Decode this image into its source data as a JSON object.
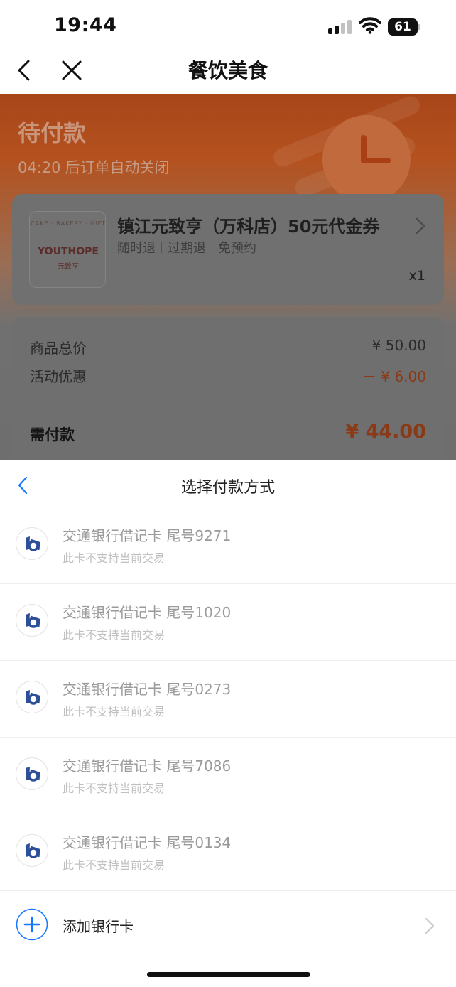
{
  "status_bar": {
    "time": "19:44",
    "battery": "61",
    "icons": [
      "signal-icon",
      "wifi-icon",
      "battery-icon"
    ]
  },
  "nav": {
    "title": "餐饮美食",
    "icons": [
      "back-icon",
      "close-icon"
    ]
  },
  "order": {
    "status": "待付款",
    "countdown_time": "04:20",
    "countdown_text": "后订单自动关闭",
    "product": {
      "logo_arc_text": "CAKE · BAKERY · GIFT",
      "logo_main_text": "YOUTHOPE",
      "logo_sub_text": "元致亨",
      "name": "镇江元致亨（万科店）50元代金券",
      "tags": [
        "随时退",
        "过期退",
        "免预约"
      ],
      "quantity": "x1"
    },
    "price": {
      "total_label": "商品总价",
      "total_value": "¥ 50.00",
      "discount_label": "活动优惠",
      "discount_value": "－ ¥ 6.00",
      "due_label": "需付款",
      "due_value": "¥ 44.00"
    }
  },
  "payment_sheet": {
    "title": "选择付款方式",
    "cards": [
      {
        "name": "交通银行借记卡 尾号9271",
        "note": "此卡不支持当前交易"
      },
      {
        "name": "交通银行借记卡 尾号1020",
        "note": "此卡不支持当前交易"
      },
      {
        "name": "交通银行借记卡 尾号0273",
        "note": "此卡不支持当前交易"
      },
      {
        "name": "交通银行借记卡 尾号7086",
        "note": "此卡不支持当前交易"
      },
      {
        "name": "交通银行借记卡 尾号0134",
        "note": "此卡不支持当前交易"
      }
    ],
    "add_card_label": "添加银行卡"
  },
  "colors": {
    "accent_orange": "#e5621f",
    "link_blue": "#1677ff",
    "disabled_text": "#9a9a9a"
  }
}
